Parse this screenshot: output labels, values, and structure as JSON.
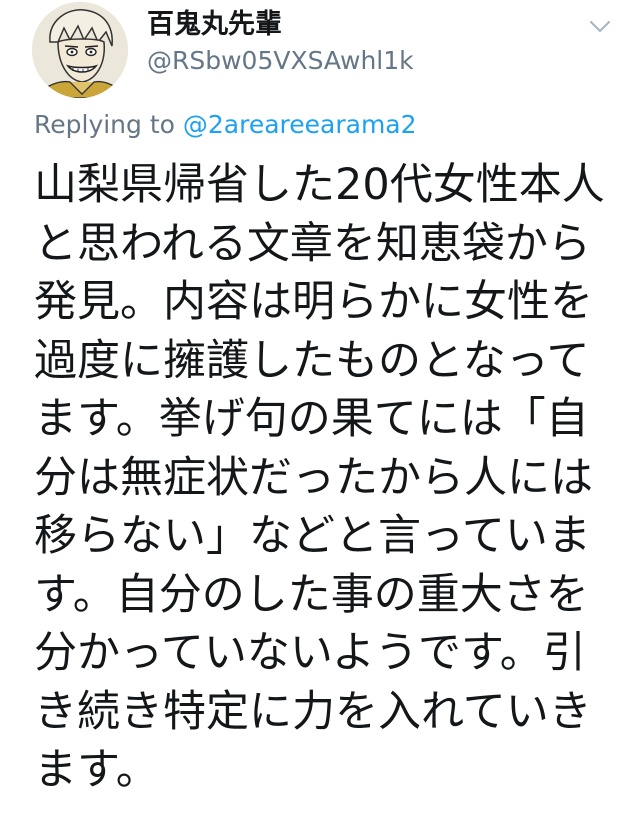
{
  "user": {
    "display_name": "百鬼丸先輩",
    "handle": "@RSbw05VXSAwhl1k",
    "avatar_icon": "profile-avatar-icon"
  },
  "menu": {
    "icon": "chevron-down-icon",
    "color": "#aab8c2"
  },
  "reply": {
    "prefix": "Replying to ",
    "mention": "@2areareearama2",
    "mention_color": "#1da1f2",
    "prefix_color": "#657786"
  },
  "tweet": {
    "text": "山梨県帰省した20代女性本人と思われる文章を知恵袋から発見。内容は明らかに女性を過度に擁護したものとなってます。挙げ句の果てには「自分は無症状だったから人には移らない」などと言っています。自分のした事の重大さを分かっていないようです。引き続き特定に力を入れていきます。"
  }
}
